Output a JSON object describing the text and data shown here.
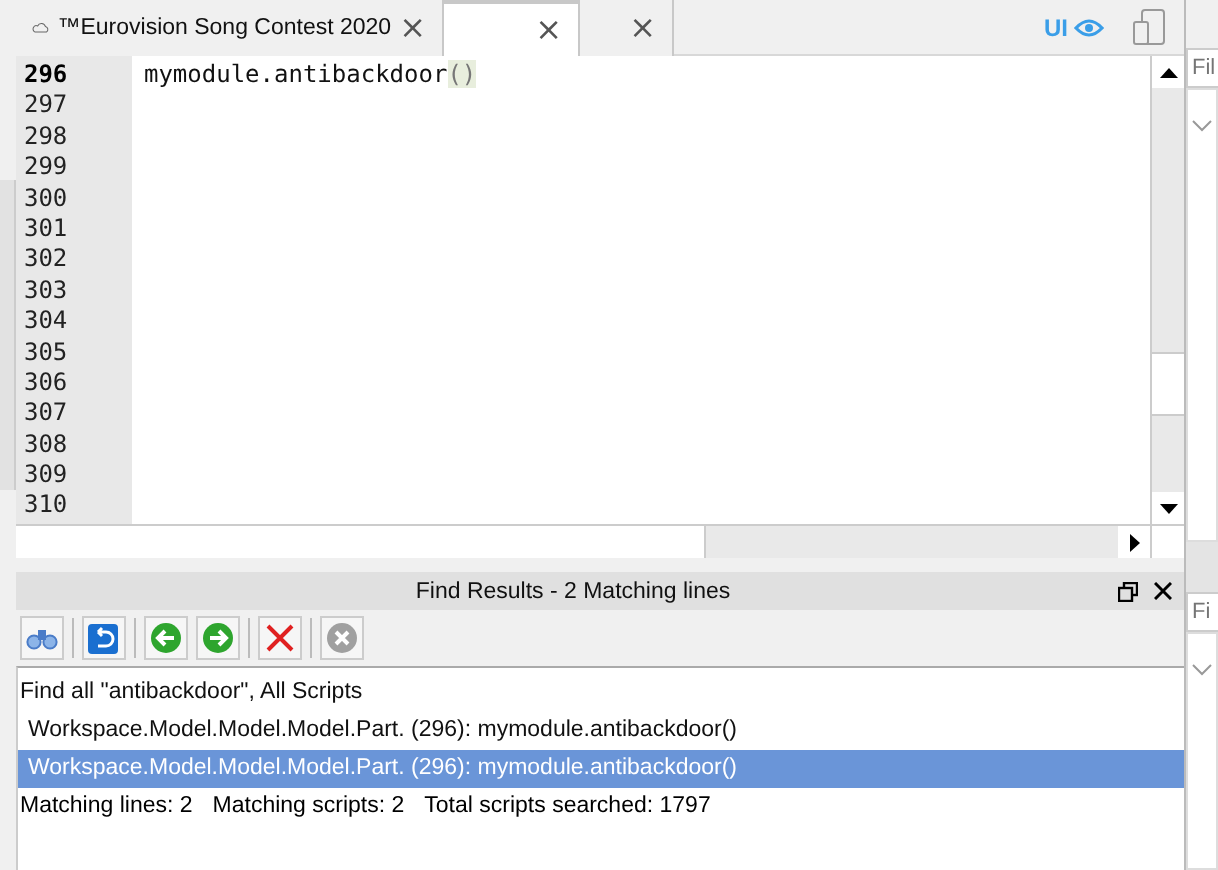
{
  "tabs": [
    {
      "label": "™Eurovision Song Contest 2020",
      "close": "×",
      "selected": false
    },
    {
      "close": "×",
      "selected": true
    },
    {
      "close": "×",
      "selected": false
    }
  ],
  "toolbar_right": {
    "ui_label": "UI"
  },
  "editor": {
    "lines": [
      {
        "number": "296",
        "code": "mymodule.antibackdoor",
        "parens": "()",
        "current": true
      },
      {
        "number": "297",
        "current": false
      },
      {
        "number": "298",
        "current": false
      },
      {
        "number": "299",
        "current": false
      },
      {
        "number": "300",
        "current": false
      },
      {
        "number": "301",
        "current": false
      },
      {
        "number": "302",
        "current": false
      },
      {
        "number": "303",
        "current": false
      },
      {
        "number": "304",
        "current": false
      },
      {
        "number": "305",
        "current": false
      },
      {
        "number": "306",
        "current": false
      },
      {
        "number": "307",
        "current": false
      },
      {
        "number": "308",
        "current": false
      },
      {
        "number": "309",
        "current": false
      },
      {
        "number": "310",
        "current": false
      }
    ]
  },
  "find_results": {
    "title": "Find Results - 2 Matching lines",
    "query": "Find all \"antibackdoor\", All Scripts",
    "results": [
      {
        "text": "Workspace.Model.Model.Model.Part. (296): mymodule.antibackdoor()",
        "selected": false
      },
      {
        "text": "Workspace.Model.Model.Model.Part. (296): mymodule.antibackdoor()",
        "selected": true
      }
    ],
    "summary": [
      "Matching lines: 2",
      "Matching scripts: 2",
      "Total scripts searched: 1797"
    ]
  },
  "side_panel": {
    "filters": [
      {
        "placeholder": "Fil"
      },
      {
        "placeholder": "Fi"
      }
    ]
  }
}
